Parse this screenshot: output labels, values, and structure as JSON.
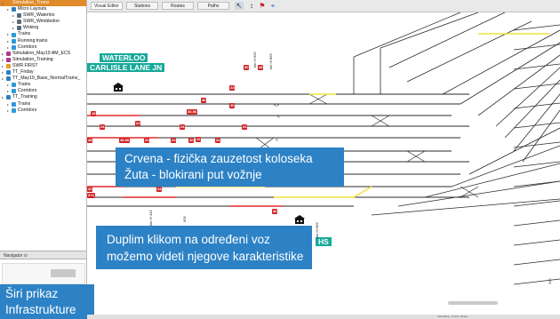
{
  "tree": [
    {
      "label": "Simulation_Trains",
      "color": "#e08a2a",
      "selected": true,
      "indent": 0
    },
    {
      "label": "Micro Layouts",
      "color": "#2d7fc4",
      "indent": 1
    },
    {
      "label": "SWR_Waterloo",
      "color": "#5a6a7a",
      "indent": 2
    },
    {
      "label": "SWR_Wimbledon",
      "color": "#5a6a7a",
      "indent": 2
    },
    {
      "label": "Woking",
      "color": "#5a6a7a",
      "indent": 2
    },
    {
      "label": "Trains",
      "color": "#2d9ad8",
      "indent": 1
    },
    {
      "label": "Running trains",
      "color": "#2d9ad8",
      "indent": 1
    },
    {
      "label": "Corridors",
      "color": "#2d9ad8",
      "indent": 1
    },
    {
      "label": "Simulation_May19 AM_ECS",
      "color": "#b03a8a",
      "indent": 0
    },
    {
      "label": "Simulation_Training",
      "color": "#b03a8a",
      "indent": 0
    },
    {
      "label": "SWR FIRST",
      "color": "#e39a2c",
      "indent": 0
    },
    {
      "label": "TT_Friday",
      "color": "#2d7fc4",
      "indent": 0
    },
    {
      "label": "TT_May19_Base_NormalTrains_",
      "color": "#2d7fc4",
      "indent": 0
    },
    {
      "label": "Trains",
      "color": "#2d9ad8",
      "indent": 1
    },
    {
      "label": "Corridors",
      "color": "#2d9ad8",
      "indent": 1
    },
    {
      "label": "TT_Training",
      "color": "#2d7fc4",
      "indent": 0
    },
    {
      "label": "Trains",
      "color": "#2d9ad8",
      "indent": 1
    },
    {
      "label": "Corridors",
      "color": "#2d9ad8",
      "indent": 1
    }
  ],
  "navigator": {
    "label": "Navigator"
  },
  "toolbar": {
    "tabs": [
      "Visual Editor",
      "Stations",
      "Routes",
      "Paths"
    ],
    "tools": [
      "cursor-tool-icon",
      "pointer-tool-icon",
      "flag-tool-icon",
      "pin-tool-icon"
    ]
  },
  "stations": {
    "waterloo": "WATERLOO",
    "carlisle": "CARLISLE LANE JN",
    "partial": "HS"
  },
  "signals": [
    "18",
    "24",
    "24",
    "40",
    "24",
    "40",
    "40",
    "40-96",
    "40",
    "24",
    "24",
    "24",
    "24",
    "40",
    "48-96",
    "24",
    "24",
    "48",
    "24",
    "24",
    "40",
    "40",
    "48",
    "32",
    "3+4"
  ],
  "km_labels": [
    "km 0+692",
    "km 0+869",
    "km 0+445",
    "km 0+589",
    "605"
  ],
  "callouts": {
    "occupancy_line1": "Crvena - fizička zauzetost koloseka",
    "occupancy_line2": "Žuta - blokirani put vožnje",
    "dblclick_line1": "Duplim klikom na određeni voz",
    "dblclick_line2": "možemo videti njegove karakteristike",
    "wide_line1": "Širi prikaz",
    "wide_line2": "Infrastrukture"
  },
  "scroll_value": "302",
  "status_text": "Simulation_Trains, Friday, ...",
  "colors": {
    "callout": "#2d82c5",
    "station": "#17a99a",
    "signal": "#d1252a",
    "occupied": "#e32b2b",
    "blocked": "#f0e23a",
    "track": "#2a2a2a"
  }
}
